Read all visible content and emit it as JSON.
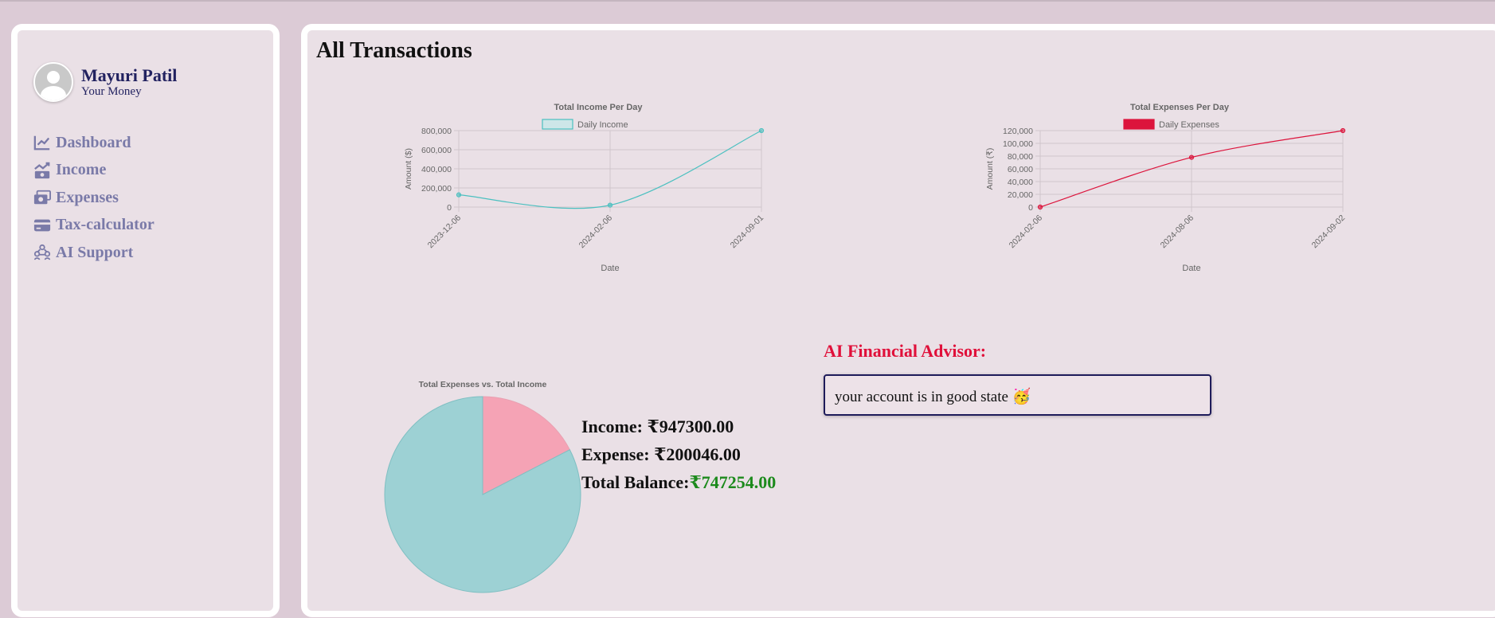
{
  "profile": {
    "name": "Mayuri Patil",
    "subtitle": "Your Money"
  },
  "nav": [
    {
      "label": "Dashboard",
      "icon": "chart-line-icon"
    },
    {
      "label": "Income",
      "icon": "money-trend-icon"
    },
    {
      "label": "Expenses",
      "icon": "money-bills-icon"
    },
    {
      "label": "Tax-calculator",
      "icon": "credit-card-icon"
    },
    {
      "label": "AI Support",
      "icon": "people-group-icon"
    }
  ],
  "main": {
    "title": "All Transactions"
  },
  "totals": {
    "income_label": "Income: ",
    "income_value": "₹947300.00",
    "expense_label": "Expense: ",
    "expense_value": "₹200046.00",
    "balance_label": "Total Balance:",
    "balance_value": "₹747254.00"
  },
  "advisor": {
    "title": "AI Financial Advisor:",
    "message": "your account is in good state 🥳"
  },
  "colors": {
    "income": "#4bc0c0",
    "expense": "#dc143c",
    "pie_income": "#9dd1d4",
    "pie_expense": "#f5a3b5",
    "nav": "#7a7aa8",
    "advisor_title": "#e0103a",
    "balance": "#1c8a1c"
  },
  "chart_data": [
    {
      "type": "line",
      "title": "Total Income Per Day",
      "legend": "Daily Income",
      "xlabel": "Date",
      "ylabel": "Amount ($)",
      "x": [
        "2023-12-06",
        "2024-02-06",
        "2024-09-01"
      ],
      "values": [
        128000,
        20000,
        800000
      ],
      "ylim": [
        0,
        800000
      ],
      "yticks": [
        0,
        200000,
        400000,
        600000,
        800000
      ],
      "ytick_labels": [
        "0",
        "200,000",
        "400,000",
        "600,000",
        "800,000"
      ],
      "grid": true
    },
    {
      "type": "line",
      "title": "Total Expenses Per Day",
      "legend": "Daily Expenses",
      "xlabel": "Date",
      "ylabel": "Amount (₹)",
      "x": [
        "2024-02-06",
        "2024-08-06",
        "2024-09-02"
      ],
      "values": [
        0,
        78000,
        120000
      ],
      "ylim": [
        0,
        120000
      ],
      "yticks": [
        0,
        20000,
        40000,
        60000,
        80000,
        100000,
        120000
      ],
      "ytick_labels": [
        "0",
        "20,000",
        "40,000",
        "60,000",
        "80,000",
        "100,000",
        "120,000"
      ],
      "grid": true
    },
    {
      "type": "pie",
      "title": "Total Expenses vs. Total Income",
      "slices": [
        {
          "label": "Expenses",
          "value": 200046
        },
        {
          "label": "Income",
          "value": 947300
        }
      ]
    }
  ]
}
